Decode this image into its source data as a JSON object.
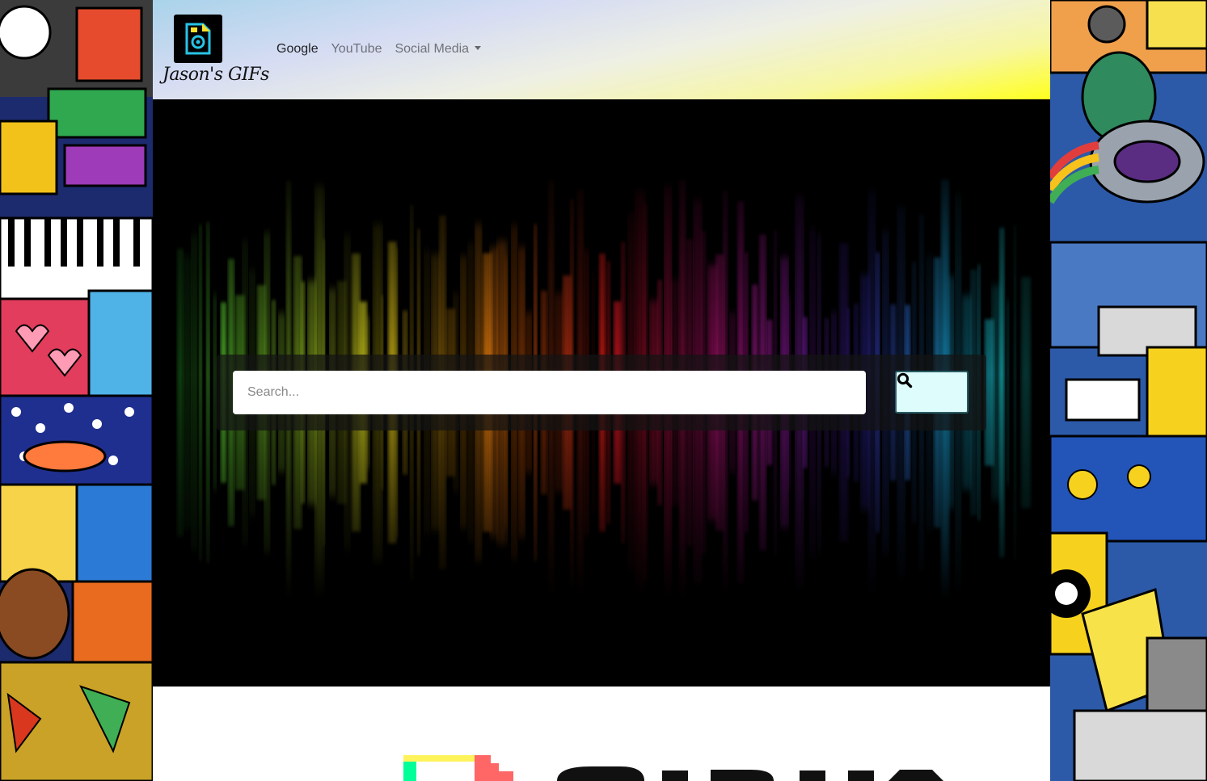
{
  "brand": {
    "name": "Jason's GIFs",
    "logo_icon": "camera-file-icon"
  },
  "nav": {
    "links": [
      {
        "label": "Google",
        "active": true
      },
      {
        "label": "YouTube",
        "active": false
      },
      {
        "label": "Social Media",
        "active": false,
        "dropdown": true
      }
    ]
  },
  "search": {
    "placeholder": "Search...",
    "button_icon": "search-icon"
  },
  "colors": {
    "accent_button_bg": "#dffcfd",
    "navbar_gradient_start": "#a9d3ea",
    "navbar_gradient_end": "#ffff1e",
    "hero_background": "#000000"
  }
}
